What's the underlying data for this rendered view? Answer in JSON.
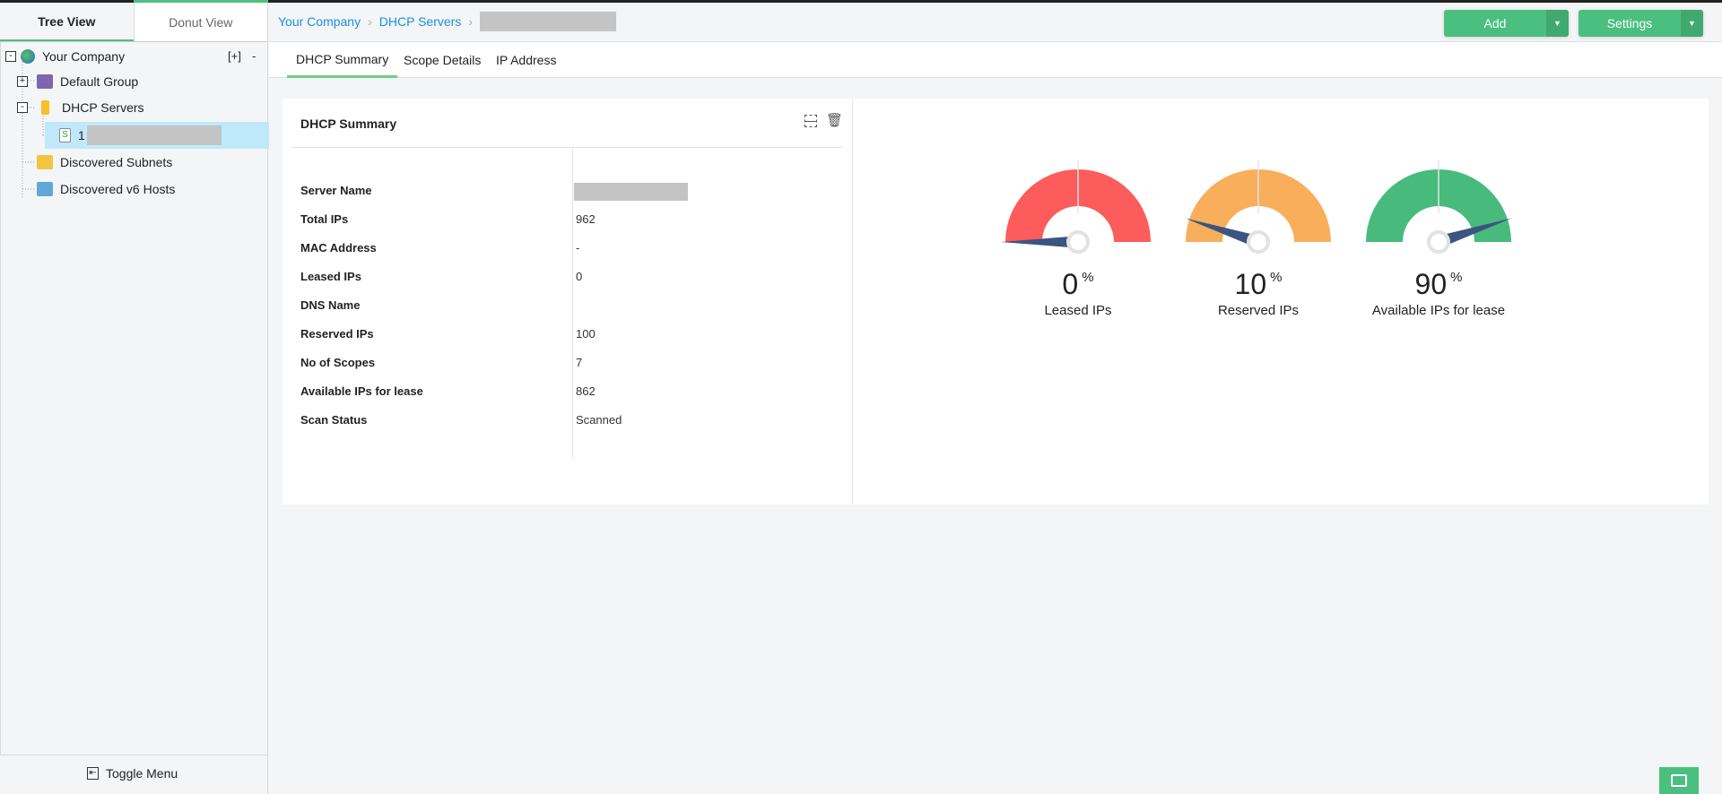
{
  "sidebar": {
    "tabs": [
      {
        "label": "Tree View",
        "active": true
      },
      {
        "label": "Donut View",
        "active": false
      }
    ],
    "expand_all": "[+]",
    "collapse_all": "-",
    "tree": [
      {
        "label": "Your Company",
        "icon": "globe-icon"
      },
      {
        "label": "Default Group",
        "icon": "folder-icon"
      },
      {
        "label": "DHCP Servers",
        "icon": "server-icon"
      },
      {
        "label": "1",
        "icon": "dhcp-server-icon"
      },
      {
        "label": "Discovered Subnets",
        "icon": "subnet-search-icon"
      },
      {
        "label": "Discovered v6 Hosts",
        "icon": "host-search-icon"
      }
    ],
    "toggle_menu": "Toggle Menu"
  },
  "header": {
    "breadcrumb": [
      "Your Company",
      "DHCP Servers"
    ],
    "add_label": "Add",
    "settings_label": "Settings"
  },
  "tabs": [
    "DHCP Summary",
    "Scope Details",
    "IP Address"
  ],
  "summary": {
    "title": "DHCP Summary",
    "rows": [
      {
        "k": "Server Name",
        "v": ""
      },
      {
        "k": "Total IPs",
        "v": "962"
      },
      {
        "k": "MAC Address",
        "v": "-"
      },
      {
        "k": "Leased IPs",
        "v": "0"
      },
      {
        "k": "DNS Name",
        "v": ""
      },
      {
        "k": "Reserved IPs",
        "v": "100"
      },
      {
        "k": "No of Scopes",
        "v": "7"
      },
      {
        "k": "Available IPs for lease",
        "v": "862"
      },
      {
        "k": "Scan Status",
        "v": "Scanned"
      }
    ]
  },
  "gauges": [
    {
      "value": "0",
      "percent": 0,
      "unit": "%",
      "label": "Leased IPs",
      "color": "#fc5c5c"
    },
    {
      "value": "10",
      "percent": 10,
      "unit": "%",
      "label": "Reserved IPs",
      "color": "#f9ae5c"
    },
    {
      "value": "90",
      "percent": 90,
      "unit": "%",
      "label": "Available IPs for lease",
      "color": "#48bb7c"
    }
  ],
  "colors": {
    "accent": "#4abf80",
    "link": "#1a8fe0",
    "needle": "#3b5580"
  }
}
